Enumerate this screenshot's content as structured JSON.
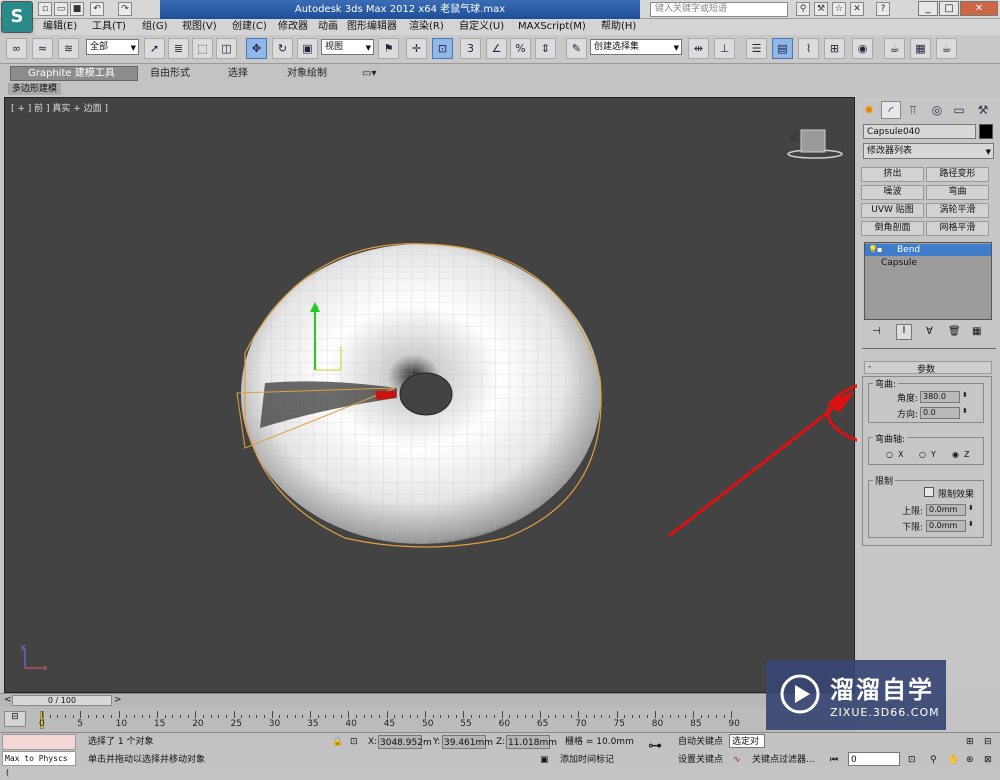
{
  "title_bar": {
    "title": "Autodesk 3ds Max  2012 x64     老鼠气球.max",
    "search_placeholder": "键入关键字或短语"
  },
  "menu": [
    "编辑(E)",
    "工具(T)",
    "组(G)",
    "视图(V)",
    "创建(C)",
    "修改器",
    "动画",
    "图形编辑器",
    "渲染(R)",
    "自定义(U)",
    "MAXScript(M)",
    "帮助(H)"
  ],
  "toolbar": {
    "selection_filter": "全部",
    "ref_coord": "视图",
    "named_selection": "创建选择集"
  },
  "ribbon": {
    "tabs": [
      "Graphite 建模工具",
      "自由形式",
      "选择",
      "对象绘制"
    ],
    "subtab": "多边形建模"
  },
  "viewport": {
    "label": "[ + ] 前 ] 真实 + 边面 ]",
    "viewcube_face": "前",
    "axis_y": "y",
    "axis_x": "x"
  },
  "command_panel": {
    "object_name": "Capsule040",
    "modifier_list": "修改器列表",
    "modifier_buttons": [
      "挤出",
      "路径变形",
      "噪波",
      "弯曲",
      "UVW 贴图",
      "涡轮平滑",
      "倒角剖面",
      "网格平滑"
    ],
    "stack": [
      "Bend",
      "Capsule"
    ],
    "rollout_title": "参数",
    "bend_group": "弯曲:",
    "angle_label": "角度:",
    "angle_value": "380.0",
    "direction_label": "方向:",
    "direction_value": "0.0",
    "axis_group": "弯曲轴:",
    "axis_x": "X",
    "axis_y": "Y",
    "axis_z": "Z",
    "limits_group": "限制",
    "limit_effect": "限制效果",
    "upper_label": "上限:",
    "upper_value": "0.0mm",
    "lower_label": "下限:",
    "lower_value": "0.0mm"
  },
  "timeline": {
    "frame": "0 / 100",
    "ticks": [
      "0",
      "5",
      "10",
      "15",
      "20",
      "25",
      "30",
      "35",
      "40",
      "45",
      "50",
      "55",
      "60",
      "65",
      "70",
      "75",
      "80",
      "85",
      "90"
    ]
  },
  "status": {
    "script_box": "Max to Physcs (",
    "selection": "选择了 1 个对象",
    "prompt": "单击并拖动以选择并移动对象",
    "x_label": "X:",
    "x_value": "3048.952m",
    "y_label": "Y:",
    "y_value": "39.461mm",
    "z_label": "Z:",
    "z_value": "11.018mm",
    "grid": "栅格 = 10.0mm",
    "auto_key": "自动关键点",
    "set_key": "设置关键点",
    "selected": "选定对象",
    "add_time_tag": "添加时间标记",
    "key_filter": "关键点过滤器...",
    "frame_value": "0"
  },
  "watermark": {
    "brand": "溜溜自学",
    "url": "ZIXUE.3D66.COM"
  },
  "colors": {
    "viewport_bg": "#434343",
    "annotation": "#dd1111",
    "selection": "#e0a040"
  }
}
